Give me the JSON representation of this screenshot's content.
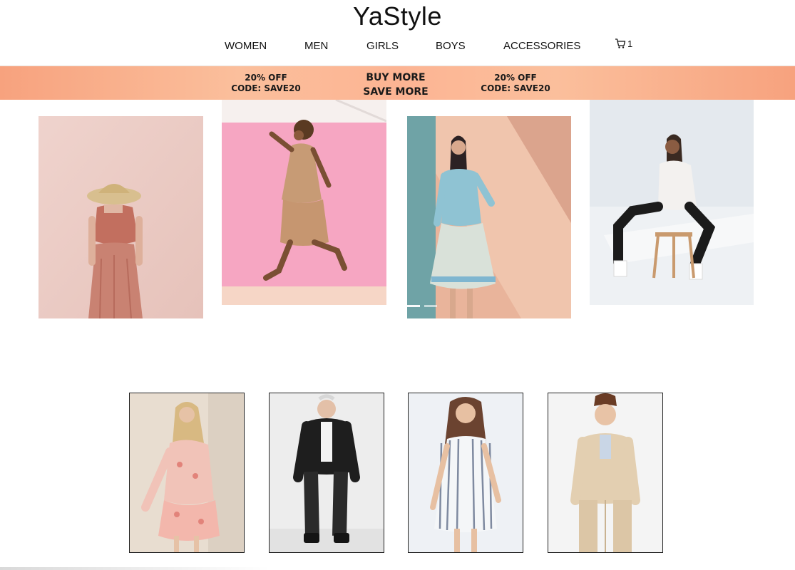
{
  "header": {
    "brand": "YaStyle"
  },
  "nav": {
    "items": [
      "WOMEN",
      "MEN",
      "GIRLS",
      "BOYS",
      "ACCESSORIES"
    ],
    "cart_icon": "cart-icon",
    "cart_count": "1"
  },
  "promo": {
    "left_line1": "20% OFF",
    "left_line2": "CODE: SAVE20",
    "center_line1": "BUY MORE",
    "center_line2": "SAVE MORE",
    "right_line1": "20% OFF",
    "right_line2": "CODE: SAVE20"
  },
  "carousel": {
    "slide_count": 2,
    "active_index": 0
  },
  "colors": {
    "promo_start": "#f7a27e",
    "promo_mid": "#fcb493",
    "text": "#111111",
    "card_border": "#222222"
  }
}
